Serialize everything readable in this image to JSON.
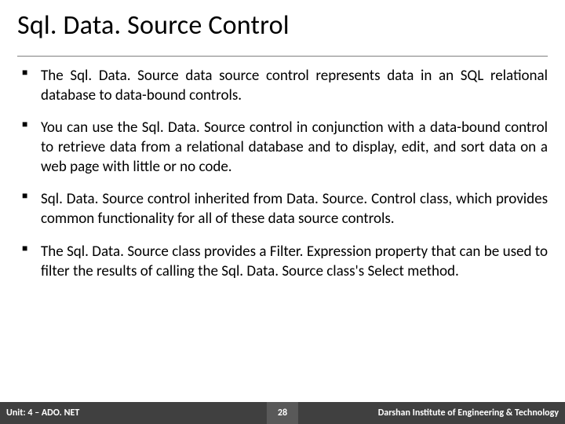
{
  "title": "Sql. Data. Source Control",
  "bullets": [
    "The Sql. Data. Source data source control represents data in an SQL relational database to data-bound controls.",
    "You can use the Sql. Data. Source control in conjunction with a data-bound control to retrieve data from a relational database and to display, edit, and sort data on a web page with little or no code.",
    "Sql. Data. Source control inherited from Data. Source. Control class, which provides common functionality for all of these data source controls.",
    "The Sql. Data. Source class provides a Filter. Expression property that can be used to filter the results of calling the Sql. Data. Source class's Select method."
  ],
  "footer": {
    "unit": "Unit: 4 – ADO. NET",
    "page": "28",
    "org": "Darshan Institute of Engineering & Technology"
  }
}
